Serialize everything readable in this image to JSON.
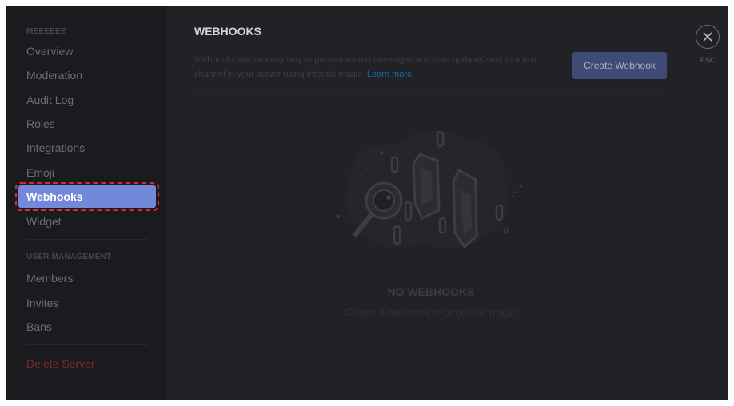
{
  "sidebar": {
    "server_header": "MEEEEEE",
    "items": [
      {
        "label": "Overview"
      },
      {
        "label": "Moderation"
      },
      {
        "label": "Audit Log"
      },
      {
        "label": "Roles"
      },
      {
        "label": "Integrations"
      },
      {
        "label": "Emoji"
      },
      {
        "label": "Webhooks",
        "selected": true
      },
      {
        "label": "Widget"
      }
    ],
    "user_management_header": "USER MANAGEMENT",
    "user_items": [
      {
        "label": "Members"
      },
      {
        "label": "Invites"
      },
      {
        "label": "Bans"
      }
    ],
    "delete_label": "Delete Server"
  },
  "main": {
    "title": "WEBHOOKS",
    "description": "Webhooks are an easy way to get automated messages and data updates sent to a text channel in your server using internet magic.",
    "learn_more": "Learn more.",
    "create_button": "Create Webhook",
    "empty_title": "NO WEBHOOKS",
    "empty_subtitle": "Create a webhook to begin the magic"
  },
  "close": {
    "icon": "close-icon",
    "esc_label": "ESC"
  },
  "colors": {
    "accent": "#7289da",
    "danger": "#f04747",
    "link": "#00b0f4"
  }
}
